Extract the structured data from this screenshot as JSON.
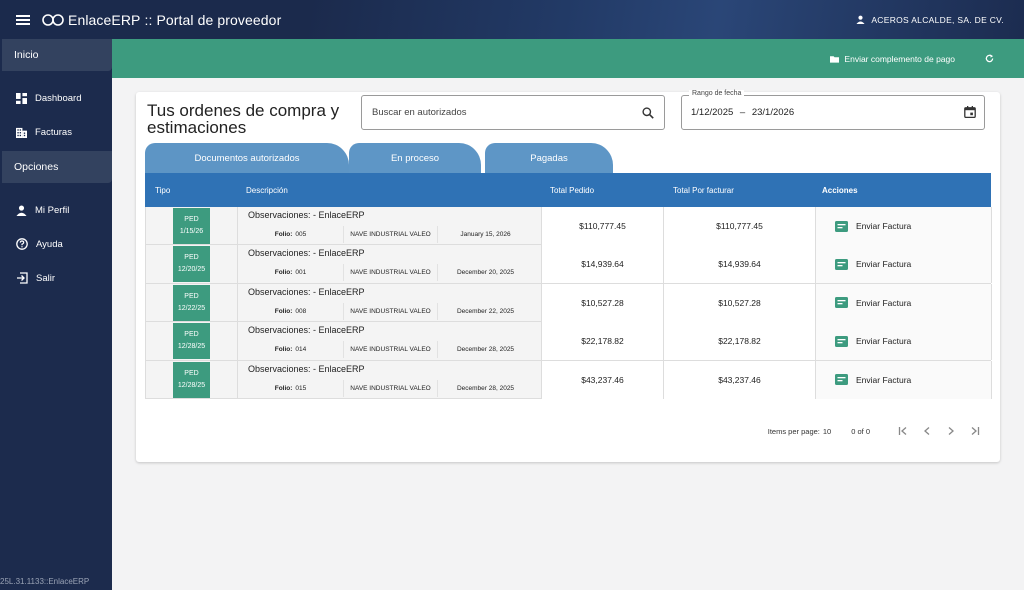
{
  "app": {
    "brand": "EnlaceERP",
    "title_suffix": ":: Portal de proveedor",
    "user": "ACEROS ALCALDE, SA. DE CV."
  },
  "sidebar": {
    "section_main": "Inicio",
    "items_main": [
      {
        "label": "Dashboard",
        "icon": "dashboard-icon"
      },
      {
        "label": "Facturas",
        "icon": "building-icon"
      }
    ],
    "section_options": "Opciones",
    "items_options": [
      {
        "label": "Mi Perfil",
        "icon": "person-icon"
      },
      {
        "label": "Ayuda",
        "icon": "help-icon"
      },
      {
        "label": "Salir",
        "icon": "logout-icon"
      }
    ],
    "version": "25L.31.1133::EnlaceERP"
  },
  "actionbar": {
    "complement_label": "Enviar complemento de pago"
  },
  "card": {
    "title": "Tus ordenes de compra y estimaciones",
    "search_placeholder": "Buscar en autorizados",
    "date_label": "Rango de fecha",
    "date_start": "1/12/2025",
    "date_sep": "–",
    "date_end": "23/1/2026"
  },
  "tabs": [
    {
      "label": "Documentos autorizados",
      "active": true
    },
    {
      "label": "En proceso",
      "active": false
    },
    {
      "label": "Pagadas",
      "active": false
    }
  ],
  "table": {
    "headers": {
      "tipo": "Tipo",
      "descripcion": "Descripción",
      "total_pedido": "Total Pedido",
      "total_por_facturar": "Total Por facturar",
      "acciones": "Acciones"
    },
    "folio_label": "Folio:",
    "rows": [
      {
        "tipo": "PED",
        "fecha": "1/15/26",
        "observaciones": "Observaciones: - EnlaceERP",
        "folio": "005",
        "ubicacion": "NAVE INDUSTRIAL VALEO",
        "fecha_larga": "January 15, 2026",
        "total_pedido": "$110,777.45",
        "total_por_facturar": "$110,777.45",
        "accion": "Enviar Factura"
      },
      {
        "tipo": "PED",
        "fecha": "12/20/25",
        "observaciones": "Observaciones: - EnlaceERP",
        "folio": "001",
        "ubicacion": "NAVE INDUSTRIAL VALEO",
        "fecha_larga": "December 20, 2025",
        "total_pedido": "$14,939.64",
        "total_por_facturar": "$14,939.64",
        "accion": "Enviar Factura"
      },
      {
        "tipo": "PED",
        "fecha": "12/22/25",
        "observaciones": "Observaciones: - EnlaceERP",
        "folio": "008",
        "ubicacion": "NAVE INDUSTRIAL VALEO",
        "fecha_larga": "December 22, 2025",
        "total_pedido": "$10,527.28",
        "total_por_facturar": "$10,527.28",
        "accion": "Enviar Factura"
      },
      {
        "tipo": "PED",
        "fecha": "12/28/25",
        "observaciones": "Observaciones: - EnlaceERP",
        "folio": "014",
        "ubicacion": "NAVE INDUSTRIAL VALEO",
        "fecha_larga": "December 28, 2025",
        "total_pedido": "$22,178.82",
        "total_por_facturar": "$22,178.82",
        "accion": "Enviar Factura"
      },
      {
        "tipo": "PED",
        "fecha": "12/28/25",
        "observaciones": "Observaciones: - EnlaceERP",
        "folio": "015",
        "ubicacion": "NAVE INDUSTRIAL VALEO",
        "fecha_larga": "December 28, 2025",
        "total_pedido": "$43,237.46",
        "total_por_facturar": "$43,237.46",
        "accion": "Enviar Factura"
      }
    ]
  },
  "pager": {
    "items_per_page_label": "Items per page:",
    "items_per_page": "10",
    "range": "0 of 0"
  },
  "colors": {
    "navy": "#1c2b4d",
    "green": "#3d9b7f",
    "tab_blue": "#5e96c6",
    "header_blue": "#2f72b5"
  }
}
